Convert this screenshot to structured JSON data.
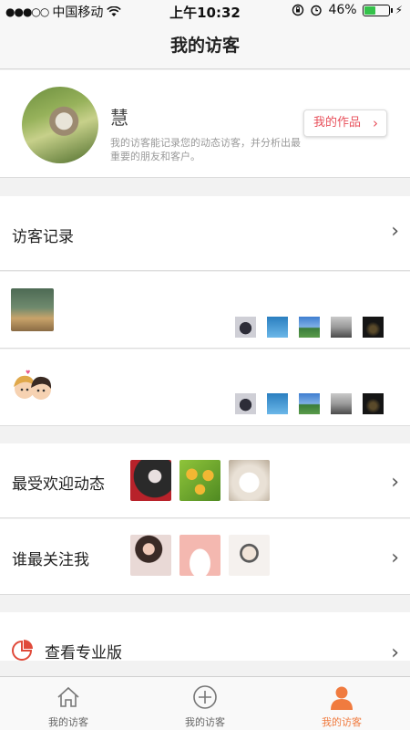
{
  "status_bar": {
    "carrier": "中国移动",
    "time": "上午10:32",
    "battery": "46%",
    "battery_level": 0.46
  },
  "nav": {
    "title": "我的访客"
  },
  "profile": {
    "name": "慧",
    "description": "我的访客能记录您的动态访客，并分析出最重要的朋友和客户。",
    "works_button": "我的作品"
  },
  "sections": {
    "visitor_records": {
      "title": "访客记录"
    },
    "popular": {
      "title": "最受欢迎动态"
    },
    "attention": {
      "title": "谁最关注我"
    },
    "pro": {
      "title": "查看专业版"
    }
  },
  "tabs": [
    {
      "label": "我的访客",
      "icon": "home-icon",
      "active": false
    },
    {
      "label": "我的访客",
      "icon": "plus-circle-icon",
      "active": false
    },
    {
      "label": "我的访客",
      "icon": "person-icon",
      "active": true
    }
  ],
  "colors": {
    "accent": "#f07b3f",
    "button_text": "#e8505b"
  }
}
